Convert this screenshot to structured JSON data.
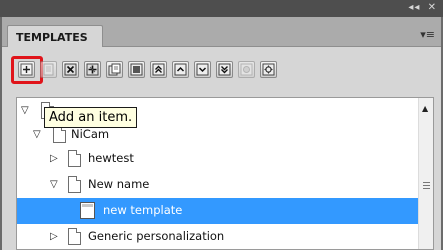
{
  "window": {
    "collapse_glyph": "◂◂",
    "close_glyph": "✕"
  },
  "tab": {
    "label": "TEMPLATES"
  },
  "panel_menu": {
    "icon": "panel-menu-icon",
    "glyph": "▾≡"
  },
  "toolbar": {
    "buttons": [
      {
        "name": "add-item-button",
        "icon": "plus-icon",
        "enabled": true
      },
      {
        "name": "button-2",
        "icon": "page-icon",
        "enabled": false
      },
      {
        "name": "delete-button",
        "icon": "delete-icon",
        "enabled": true
      },
      {
        "name": "button-4",
        "icon": "move-icon",
        "enabled": true
      },
      {
        "name": "button-5",
        "icon": "copy-icon",
        "enabled": true
      },
      {
        "name": "button-6",
        "icon": "duplicate-icon",
        "enabled": true
      },
      {
        "name": "move-top-button",
        "icon": "double-up-icon",
        "enabled": true
      },
      {
        "name": "move-up-button",
        "icon": "up-icon",
        "enabled": true
      },
      {
        "name": "move-down-button",
        "icon": "down-icon",
        "enabled": true
      },
      {
        "name": "move-bottom-button",
        "icon": "double-down-icon",
        "enabled": true
      },
      {
        "name": "button-11",
        "icon": "circle-icon",
        "enabled": false
      },
      {
        "name": "button-12",
        "icon": "settings-icon",
        "enabled": true
      }
    ]
  },
  "tooltip": {
    "text": "Add an item."
  },
  "tree": {
    "items": [
      {
        "label": "",
        "level": 0,
        "expanded": true,
        "type": "folder"
      },
      {
        "label": "NiCam",
        "level": 1,
        "expanded": true,
        "type": "folder"
      },
      {
        "label": "hewtest",
        "level": 2,
        "expanded": false,
        "type": "folder"
      },
      {
        "label": "New name",
        "level": 2,
        "expanded": true,
        "type": "folder"
      },
      {
        "label": "new template",
        "level": 3,
        "type": "template",
        "selected": true
      },
      {
        "label": "Generic personalization",
        "level": 2,
        "expanded": false,
        "type": "folder"
      }
    ]
  },
  "colors": {
    "selection": "#3399ff",
    "highlight": "#e0141a",
    "tooltip_bg": "#ffffe1",
    "panel_bg": "#d6d6d6",
    "header_bg": "#4e4e4e"
  }
}
